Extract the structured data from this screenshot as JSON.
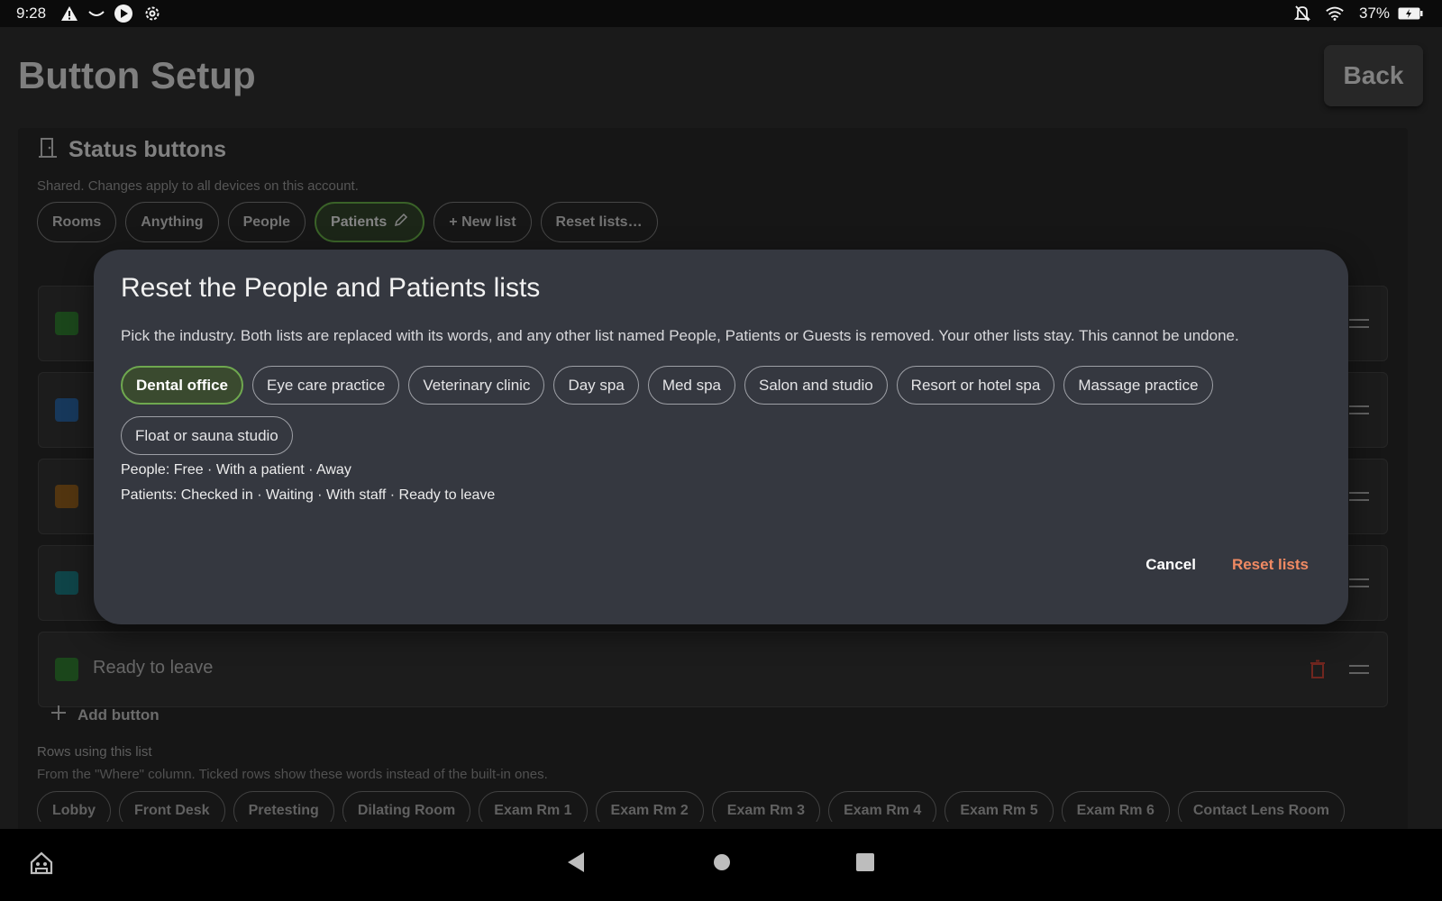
{
  "status_bar": {
    "time": "9:28",
    "battery": "37%",
    "icons": [
      "warning-icon",
      "sync-icon",
      "play-icon",
      "settings-icon",
      "notifications-off-icon",
      "wifi-icon",
      "battery-charging-icon"
    ]
  },
  "header": {
    "title": "Button Setup",
    "back_label": "Back"
  },
  "card": {
    "title": "Status buttons",
    "subtitle": "Shared. Changes apply to all devices on this account.",
    "tabs": [
      {
        "label": "Rooms"
      },
      {
        "label": "Anything"
      },
      {
        "label": "People"
      },
      {
        "label": "Patients",
        "active": true
      },
      {
        "label": "+ New list"
      },
      {
        "label": "Reset lists…"
      }
    ],
    "rows": [
      {
        "color": "#1e4d1e",
        "label": ""
      },
      {
        "color": "#1a3d63",
        "label": ""
      },
      {
        "color": "#5a3a12",
        "label": ""
      },
      {
        "color": "#114a4f",
        "label": ""
      },
      {
        "color": "#1e4d1e",
        "label": "Ready to leave"
      }
    ],
    "add_button_label": "Add button",
    "rows_using_title": "Rows using this list",
    "rows_using_sub": "From the \"Where\" column. Ticked rows show these words instead of the built-in ones.",
    "rows_using_chips": [
      "Lobby",
      "Front Desk",
      "Pretesting",
      "Dilating Room",
      "Exam Rm 1",
      "Exam Rm 2",
      "Exam Rm 3",
      "Exam Rm 4",
      "Exam Rm 5",
      "Exam Rm 6",
      "Contact Lens Room"
    ]
  },
  "dialog": {
    "title": "Reset the People and Patients lists",
    "description": "Pick the industry. Both lists are replaced with its words, and any other list named People, Patients or Guests is removed. Your other lists stay. This cannot be undone.",
    "industries": [
      {
        "label": "Dental office",
        "selected": true
      },
      {
        "label": "Eye care practice"
      },
      {
        "label": "Veterinary clinic"
      },
      {
        "label": "Day spa"
      },
      {
        "label": "Med spa"
      },
      {
        "label": "Salon and studio"
      },
      {
        "label": "Resort or hotel spa"
      },
      {
        "label": "Massage practice"
      },
      {
        "label": "Float or sauna studio"
      }
    ],
    "people_preview": "People: Free · With a patient · Away",
    "patients_preview": "Patients: Checked in · Waiting · With staff · Ready to leave",
    "cancel_label": "Cancel",
    "confirm_label": "Reset lists",
    "selected_color": "#6fa84f",
    "danger_color": "#f08a63"
  }
}
